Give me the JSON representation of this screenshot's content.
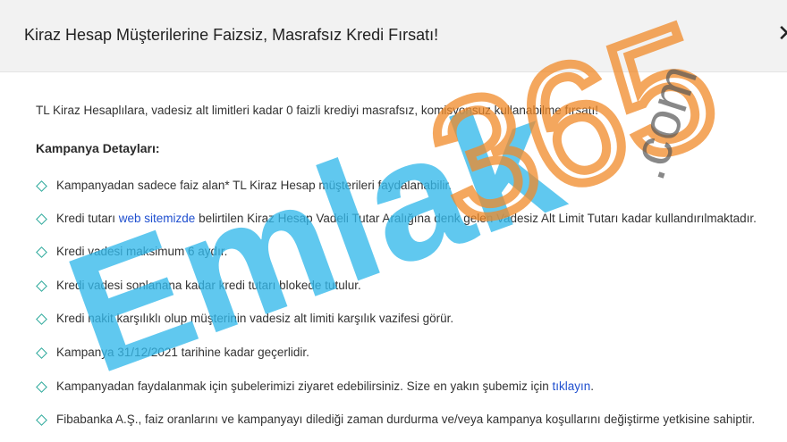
{
  "modal": {
    "title": "Kiraz Hesap Müşterilerine Faizsiz, Masrafsız Kredi Fırsatı!",
    "close_symbol": "✕"
  },
  "content": {
    "intro": "TL Kiraz Hesaplılara, vadesiz alt limitleri kadar 0 faizli krediyi masrafsız, komisyonsuz kullanabilme fırsatı!",
    "section_title": "Kampanya Detayları:",
    "items": [
      {
        "text": "Kampanyadan sadece faiz alan* TL Kiraz Hesap müşterileri faydalanabilir."
      },
      {
        "before": "Kredi tutarı ",
        "link": "web sitemizde",
        "after": " belirtilen Kiraz Hesap Vadeli Tutar Aralığına denk gelen Vadesiz Alt Limit Tutarı kadar kullandırılmaktadır."
      },
      {
        "text": "Kredi vadesi maksimum 6 aydır."
      },
      {
        "text": "Kredi vadesi sonlanana kadar kredi tutarı blokede tutulur."
      },
      {
        "text": "Kredi nakit karşılıklı olup müşterinin vadesiz alt limiti karşılık vazifesi görür."
      },
      {
        "text": "Kampanya 31/12/2021 tarihine kadar geçerlidir."
      },
      {
        "before": "Kampanyadan faydalanmak için şubelerimizi ziyaret edebilirsiniz. Size en yakın şubemiz için ",
        "link": "tıklayın",
        "after": "."
      },
      {
        "text": "Fibabanka A.Ş., faiz oranlarını ve kampanyayı dilediği zaman durdurma ve/veya kampanya koşullarını değiştirme yetkisine sahiptir."
      }
    ]
  },
  "watermark": {
    "main": "Emlak",
    "number": "365",
    "suffix": ".com",
    "colors": {
      "main": "#33b8ea",
      "number": "#f08a28",
      "suffix": "#555555"
    }
  },
  "colors": {
    "header_bg": "#f2f2f2",
    "bullet": "#2aa89a",
    "link": "#1f4fcf"
  }
}
